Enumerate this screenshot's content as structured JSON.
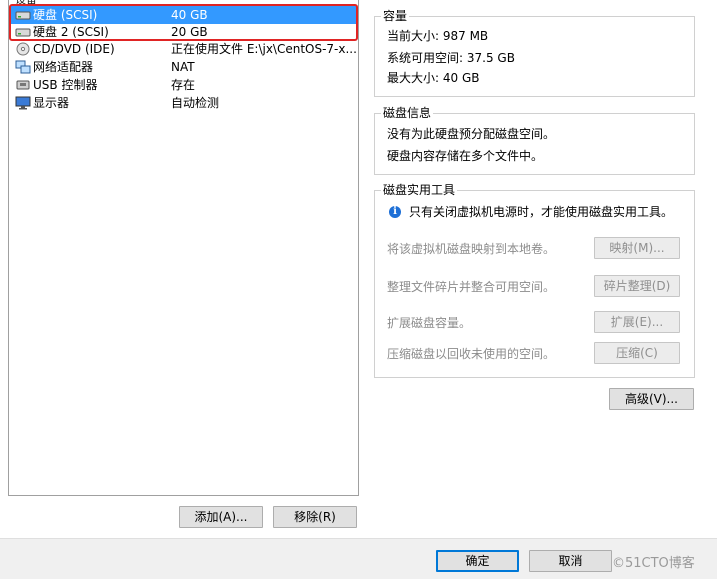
{
  "device_list": {
    "header": "设备",
    "rows": [
      {
        "name": "硬盘 (SCSI)",
        "summary": "40 GB",
        "icon": "hard-disk-icon",
        "selected": true
      },
      {
        "name": "硬盘 2 (SCSI)",
        "summary": "20 GB",
        "icon": "hard-disk-icon",
        "selected": false
      },
      {
        "name": "CD/DVD (IDE)",
        "summary": "正在使用文件 E:\\jx\\CentOS-7-x...",
        "icon": "cd-dvd-icon",
        "selected": false
      },
      {
        "name": "网络适配器",
        "summary": "NAT",
        "icon": "network-adapter-icon",
        "selected": false
      },
      {
        "name": "USB 控制器",
        "summary": "存在",
        "icon": "usb-icon",
        "selected": false
      },
      {
        "name": "显示器",
        "summary": "自动检测",
        "icon": "display-icon",
        "selected": false
      }
    ],
    "add_button": "添加(A)...",
    "remove_button": "移除(R)"
  },
  "capacity": {
    "title": "容量",
    "current_size": "当前大小: 987 MB",
    "system_free": "系统可用空间: 37.5 GB",
    "max_size": "最大大小: 40 GB"
  },
  "disk_info": {
    "title": "磁盘信息",
    "line1": "没有为此硬盘预分配磁盘空间。",
    "line2": "硬盘内容存储在多个文件中。"
  },
  "disk_utilities": {
    "title": "磁盘实用工具",
    "notice": "只有关闭虚拟机电源时，才能使用磁盘实用工具。",
    "map_desc": "将该虚拟机磁盘映射到本地卷。",
    "map_button": "映射(M)...",
    "defrag_desc": "整理文件碎片并整合可用空间。",
    "defrag_button": "碎片整理(D)",
    "expand_desc": "扩展磁盘容量。",
    "expand_button": "扩展(E)...",
    "compact_desc": "压缩磁盘以回收未使用的空间。",
    "compact_button": "压缩(C)"
  },
  "advanced_button": "高级(V)...",
  "footer": {
    "ok": "确定",
    "cancel": "取消",
    "watermark": "©51CTO博客"
  },
  "colors": {
    "selection": "#3399ff",
    "highlight_outline": "#e02424",
    "default_button_border": "#0078d7"
  }
}
